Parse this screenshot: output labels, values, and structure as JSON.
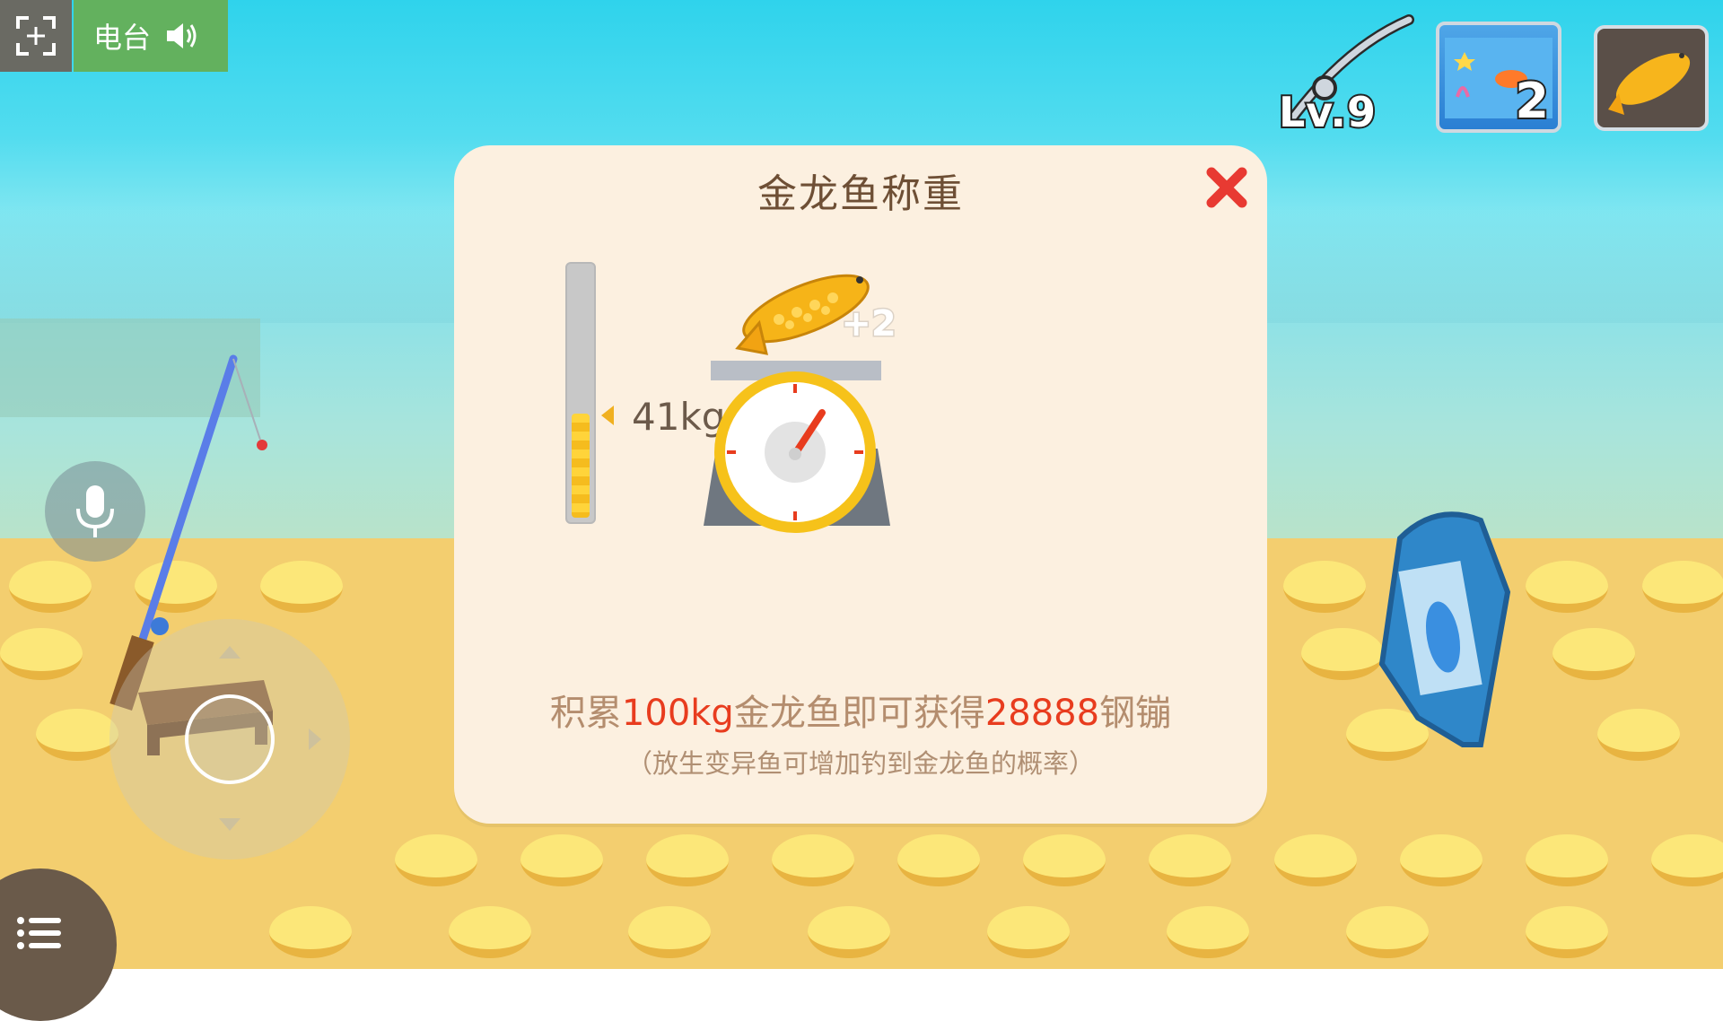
{
  "hud": {
    "radio_label": "电台",
    "fullscreen_icon": "fullscreen-icon",
    "speaker_icon": "speaker-icon",
    "level_text": "Lv.9",
    "tank_count": "2"
  },
  "dialog": {
    "title": "金龙鱼称重",
    "weight_label": "41kg",
    "weight_progress": 0.41,
    "fish_badge": "+2",
    "reward_parts": {
      "p1": "积累",
      "goal": "100kg",
      "p2": "金龙鱼即可获得",
      "amount": "28888",
      "p3": "钢镚"
    },
    "hint": "（放生变异鱼可增加钓到金龙鱼的概率）"
  },
  "colors": {
    "accent_red": "#e83c1e",
    "dialog_bg": "#fcf0e0",
    "radio_green": "#63b15e",
    "gauge_yellow": "#ffd43a"
  }
}
